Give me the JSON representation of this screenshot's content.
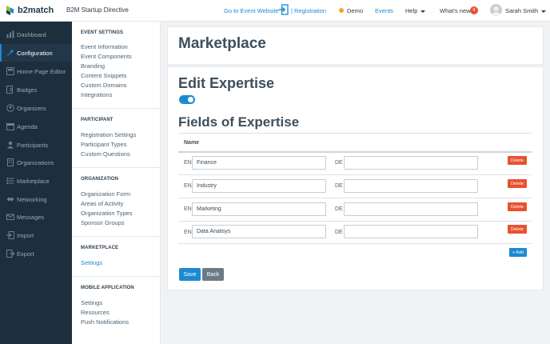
{
  "header": {
    "brand": "b2match",
    "event_name": "B2M Startup Directive",
    "go_to_event": "Go to Event Website",
    "registration": "| Registration",
    "demo": "Demo",
    "events": "Events",
    "help": "Help",
    "whats_new": "What's new",
    "whats_new_count": "4",
    "user_name": "Sarah Smith"
  },
  "sidebar": {
    "items": [
      {
        "label": "Dashboard",
        "icon": "dashboard-icon"
      },
      {
        "label": "Configuration",
        "icon": "wrench-icon"
      },
      {
        "label": "Home Page Editor",
        "icon": "home-page-editor-icon"
      },
      {
        "label": "Badges",
        "icon": "badge-icon"
      },
      {
        "label": "Organizers",
        "icon": "organizers-icon"
      },
      {
        "label": "Agenda",
        "icon": "calendar-icon"
      },
      {
        "label": "Participants",
        "icon": "participants-icon"
      },
      {
        "label": "Organizations",
        "icon": "building-icon"
      },
      {
        "label": "Marketplace",
        "icon": "marketplace-icon"
      },
      {
        "label": "Networking",
        "icon": "networking-icon"
      },
      {
        "label": "Messages",
        "icon": "envelope-icon"
      },
      {
        "label": "Import",
        "icon": "import-icon"
      },
      {
        "label": "Export",
        "icon": "export-icon"
      }
    ]
  },
  "subnav": {
    "event_settings": {
      "heading": "EVENT SETTINGS",
      "links": [
        "Event Information",
        "Event Components",
        "Branding",
        "Content Snippets",
        "Custom Domains",
        "Integrations"
      ]
    },
    "participant": {
      "heading": "PARTICIPANT",
      "links": [
        "Registration Settings",
        "Participant Types",
        "Custom Questions"
      ]
    },
    "organization": {
      "heading": "ORGANIZATION",
      "links": [
        "Organization Form",
        "Areas of Activity",
        "Organization Types",
        "Sponsor Groups"
      ]
    },
    "marketplace": {
      "heading": "MARKETPLACE",
      "links": [
        "Settings"
      ]
    },
    "mobile": {
      "heading": "MOBILE APPLICATION",
      "links": [
        "Settings",
        "Resources",
        "Push Notifications"
      ]
    }
  },
  "main": {
    "page_title": "Marketplace",
    "edit_title": "Edit Expertise",
    "toggle_on": true,
    "fields_title": "Fields of Expertise",
    "column_name": "Name",
    "lang_en": "EN",
    "lang_de": "DE",
    "rows": [
      {
        "en": "Finance",
        "de": ""
      },
      {
        "en": "Industry",
        "de": ""
      },
      {
        "en": "Marketing",
        "de": ""
      },
      {
        "en": "Data Analisys",
        "de": ""
      }
    ],
    "delete_label": "Delete",
    "add_label": "+ Add",
    "save_label": "Save",
    "back_label": "Back"
  },
  "colors": {
    "accent": "#1c8ad1",
    "danger": "#e8522f",
    "sidebar_bg": "#1d2f3c",
    "demo_dot": "#f2a524"
  }
}
